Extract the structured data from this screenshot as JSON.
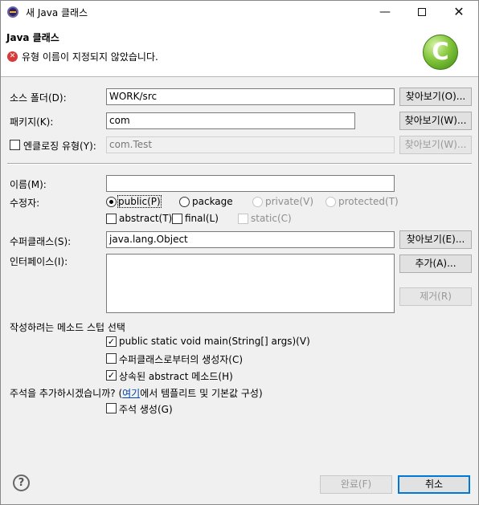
{
  "window": {
    "title": "새 Java 클래스",
    "min": "—",
    "close": "✕"
  },
  "header": {
    "title": "Java 클래스",
    "error_icon": "error-x-icon",
    "error_mark": "✕",
    "error_message": "유형 이름이 지정되지 않았습니다.",
    "banner_letter": "C"
  },
  "source_folder": {
    "label": "소스 폴더(D):",
    "value": "WORK/src",
    "browse": "찾아보기(O)..."
  },
  "package": {
    "label": "패키지(K):",
    "value": "com",
    "browse": "찾아보기(W)..."
  },
  "enclosing": {
    "label": "엔클로징 유형(Y):",
    "value": "com.Test",
    "browse": "찾아보기(W)..."
  },
  "name": {
    "label": "이름(M):",
    "value": ""
  },
  "modifiers": {
    "label": "수정자:",
    "public": "public(P)",
    "package": "package",
    "private": "private(V)",
    "protected": "protected(T)",
    "abstract": "abstract(T)",
    "final": "final(L)",
    "static": "static(C)"
  },
  "superclass": {
    "label": "수퍼클래스(S):",
    "value": "java.lang.Object",
    "browse": "찾아보기(E)..."
  },
  "interfaces": {
    "label": "인터페이스(I):",
    "add": "추가(A)...",
    "remove": "제거(R)"
  },
  "stubs": {
    "label": "작성하려는 메소드 스텁 선택",
    "main": "public static void main(String[] args)(V)",
    "constructors": "수퍼클래스로부터의 생성자(C)",
    "inherited": "상속된 abstract 메소드(H)",
    "checkmark": "✓"
  },
  "comments": {
    "question_pre": "주석을 추가하시겠습니까? (",
    "link": "여기",
    "question_post": "에서 템플리트 및 기본값 구성)",
    "generate": "주석 생성(G)"
  },
  "footer": {
    "help": "?",
    "finish": "완료(F)",
    "cancel": "취소"
  }
}
